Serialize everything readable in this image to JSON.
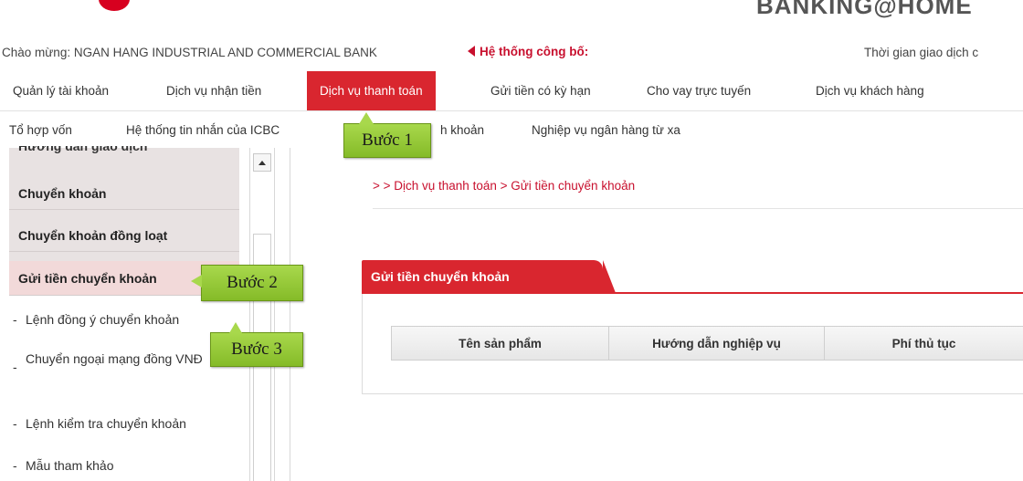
{
  "banner": {
    "brand_text": "BANKING@HOME",
    "brand_color": "#d7001f"
  },
  "welcome": {
    "greeting": "Chào mừng: NGAN HANG INDUSTRIAL AND COMMERCIAL BANK",
    "announce_label": "Hệ thống công bố:",
    "time_label": "Thời gian giao dịch c"
  },
  "menu": {
    "row1": [
      {
        "label": "Quản lý tài khoản"
      },
      {
        "label": "Dịch vụ nhận tiền"
      },
      {
        "label": "Dịch vụ thanh toán",
        "active": true
      },
      {
        "label": "Gửi tiền có kỳ hạn"
      },
      {
        "label": "Cho vay trực tuyến"
      },
      {
        "label": "Dịch vụ khách hàng"
      }
    ],
    "row2": [
      {
        "label": "Tổ hợp vốn"
      },
      {
        "label": "Hệ thống tin nhắn của ICBC"
      },
      {
        "label": "h khoản"
      },
      {
        "label": "Nghiệp vụ ngân hàng từ xa"
      }
    ]
  },
  "callouts": {
    "step1": "Bước 1",
    "step2": "Bước 2",
    "step3": "Bước 3"
  },
  "sidebar": {
    "cut_heading": "Hướng dẫn giao dịch",
    "items": [
      {
        "label": "Chuyển khoản"
      },
      {
        "label": "Chuyển khoản đồng loạt"
      },
      {
        "label": "Gửi tiền chuyển khoản"
      },
      {
        "label": "Lệnh đồng ý chuyển khoản"
      },
      {
        "label": "Chuyển ngoại mạng đồng VNĐ"
      },
      {
        "label": "Lệnh kiểm tra chuyển khoản"
      },
      {
        "label": "Mẫu tham khảo"
      }
    ]
  },
  "main": {
    "breadcrumb": "> > Dịch vụ thanh toán > Gửi tiền chuyển khoản",
    "tab_title": "Gửi tiền chuyển khoản",
    "table_headers": [
      "Tên sản phẩm",
      "Hướng dẫn nghiệp vụ",
      "Phí thủ tục"
    ]
  },
  "colors": {
    "accent_red": "#d9262f",
    "link_red": "#c8102e",
    "callout_green": "#a8d84c"
  }
}
